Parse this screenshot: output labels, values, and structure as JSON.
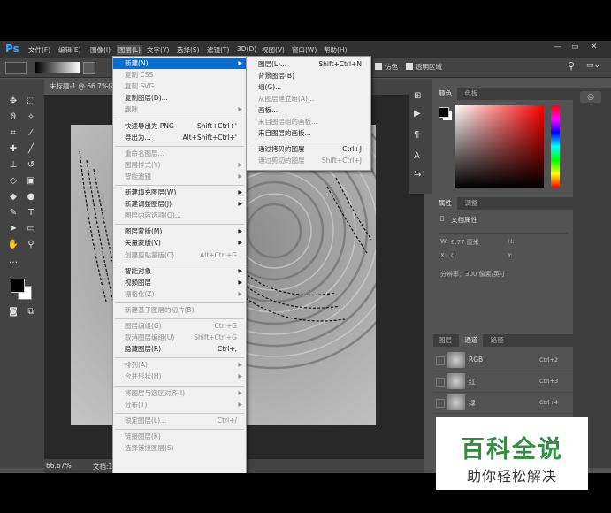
{
  "app": {
    "logo": "Ps"
  },
  "menubar": {
    "items": [
      "文件(F)",
      "编辑(E)",
      "图像(I)",
      "图层(L)",
      "文字(Y)",
      "选择(S)",
      "滤镜(T)",
      "3D(D)",
      "视图(V)",
      "窗口(W)",
      "帮助(H)"
    ],
    "active": "图层(L)"
  },
  "window_controls": {
    "minimize": "—",
    "restore": "▭",
    "close": "✕"
  },
  "options_bar": {
    "checkbox1": "仿色",
    "checkbox2": "透明区域"
  },
  "document": {
    "tab_title": "未标题-1 @ 66.7%(灰...",
    "zoom": "66.67%",
    "status_text": "文档:1"
  },
  "layer_menu": [
    {
      "label": "新建(N)",
      "shortcut": "",
      "submenu": true,
      "enabled": true,
      "highlighted": true
    },
    {
      "label": "复制 CSS",
      "shortcut": "",
      "submenu": false,
      "enabled": false
    },
    {
      "label": "复制 SVG",
      "shortcut": "",
      "submenu": false,
      "enabled": false
    },
    {
      "label": "复制图层(D)...",
      "shortcut": "",
      "submenu": false,
      "enabled": true
    },
    {
      "label": "删除",
      "shortcut": "",
      "submenu": true,
      "enabled": false
    },
    {
      "sep": true
    },
    {
      "label": "快速导出为 PNG",
      "shortcut": "Shift+Ctrl+'",
      "submenu": false,
      "enabled": true
    },
    {
      "label": "导出为...",
      "shortcut": "Alt+Shift+Ctrl+'",
      "submenu": false,
      "enabled": true
    },
    {
      "sep": true
    },
    {
      "label": "重命名图层...",
      "shortcut": "",
      "submenu": false,
      "enabled": false
    },
    {
      "label": "图层样式(Y)",
      "shortcut": "",
      "submenu": true,
      "enabled": false
    },
    {
      "label": "智能滤镜",
      "shortcut": "",
      "submenu": true,
      "enabled": false
    },
    {
      "sep": true
    },
    {
      "label": "新建填充图层(W)",
      "shortcut": "",
      "submenu": true,
      "enabled": true
    },
    {
      "label": "新建调整图层(J)",
      "shortcut": "",
      "submenu": true,
      "enabled": true
    },
    {
      "label": "图层内容选项(O)...",
      "shortcut": "",
      "submenu": false,
      "enabled": false
    },
    {
      "sep": true
    },
    {
      "label": "图层蒙版(M)",
      "shortcut": "",
      "submenu": true,
      "enabled": true
    },
    {
      "label": "矢量蒙版(V)",
      "shortcut": "",
      "submenu": true,
      "enabled": true
    },
    {
      "label": "创建剪贴蒙版(C)",
      "shortcut": "Alt+Ctrl+G",
      "submenu": false,
      "enabled": false
    },
    {
      "sep": true
    },
    {
      "label": "智能对象",
      "shortcut": "",
      "submenu": true,
      "enabled": true
    },
    {
      "label": "视频图层",
      "shortcut": "",
      "submenu": true,
      "enabled": true
    },
    {
      "label": "栅格化(Z)",
      "shortcut": "",
      "submenu": true,
      "enabled": false
    },
    {
      "sep": true
    },
    {
      "label": "新建基于图层的切片(B)",
      "shortcut": "",
      "submenu": false,
      "enabled": false
    },
    {
      "sep": true
    },
    {
      "label": "图层编组(G)",
      "shortcut": "Ctrl+G",
      "submenu": false,
      "enabled": false
    },
    {
      "label": "取消图层编组(U)",
      "shortcut": "Shift+Ctrl+G",
      "submenu": false,
      "enabled": false
    },
    {
      "label": "隐藏图层(R)",
      "shortcut": "Ctrl+,",
      "submenu": false,
      "enabled": true
    },
    {
      "sep": true
    },
    {
      "label": "排列(A)",
      "shortcut": "",
      "submenu": true,
      "enabled": false
    },
    {
      "label": "合并形状(H)",
      "shortcut": "",
      "submenu": true,
      "enabled": false
    },
    {
      "sep": true
    },
    {
      "label": "将图层与选区对齐(I)",
      "shortcut": "",
      "submenu": true,
      "enabled": false
    },
    {
      "label": "分布(T)",
      "shortcut": "",
      "submenu": true,
      "enabled": false
    },
    {
      "sep": true
    },
    {
      "label": "锁定图层(L)...",
      "shortcut": "Ctrl+/",
      "submenu": false,
      "enabled": false
    },
    {
      "sep": true
    },
    {
      "label": "链接图层(K)",
      "shortcut": "",
      "submenu": false,
      "enabled": false
    },
    {
      "label": "选择链接图层(S)",
      "shortcut": "",
      "submenu": false,
      "enabled": false
    }
  ],
  "new_submenu": [
    {
      "label": "图层(L)...",
      "shortcut": "Shift+Ctrl+N",
      "enabled": true
    },
    {
      "label": "背景图层(B)",
      "shortcut": "",
      "enabled": true
    },
    {
      "label": "组(G)...",
      "shortcut": "",
      "enabled": true
    },
    {
      "label": "从图层建立组(A)...",
      "shortcut": "",
      "enabled": false
    },
    {
      "label": "画板...",
      "shortcut": "",
      "enabled": true
    },
    {
      "label": "来自图层组的画板...",
      "shortcut": "",
      "enabled": false
    },
    {
      "label": "来自图层的画板...",
      "shortcut": "",
      "enabled": true
    },
    {
      "sep": true
    },
    {
      "label": "通过拷贝的图层",
      "shortcut": "Ctrl+J",
      "enabled": true
    },
    {
      "label": "通过剪切的图层",
      "shortcut": "Shift+Ctrl+J",
      "enabled": false
    }
  ],
  "color_panel": {
    "tabs": [
      "颜色",
      "色板"
    ]
  },
  "properties_panel": {
    "tabs": [
      "属性",
      "调整"
    ],
    "heading": "文档属性",
    "w_label": "W:",
    "w_value": "6.77 厘米",
    "h_label": "H:",
    "x_label": "X:",
    "x_value": "0",
    "y_label": "Y:",
    "resolution": "分辨率：300 像素/英寸"
  },
  "channels_panel": {
    "tabs": [
      "图层",
      "通道",
      "路径"
    ],
    "channels": [
      {
        "name": "RGB",
        "shortcut": "Ctrl+2"
      },
      {
        "name": "红",
        "shortcut": "Ctrl+3"
      },
      {
        "name": "绿",
        "shortcut": "Ctrl+4"
      }
    ]
  },
  "watermark": {
    "title": "百科全说",
    "subtitle": "助你轻松解决"
  }
}
